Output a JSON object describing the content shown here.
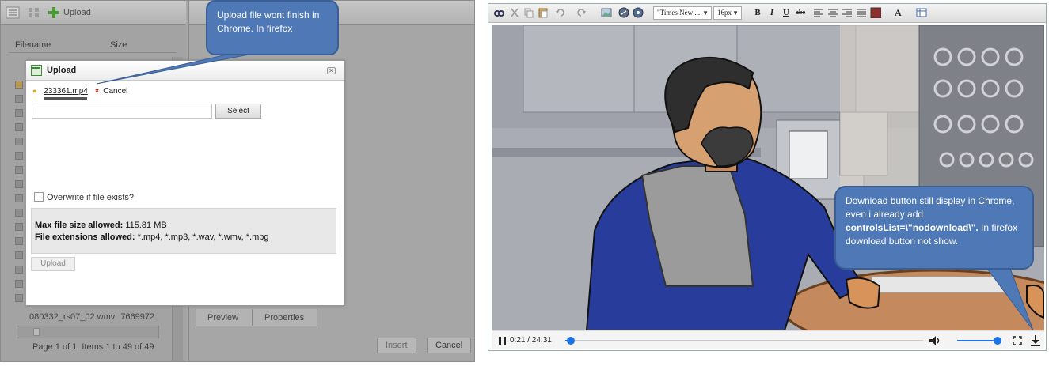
{
  "left": {
    "toolbar": {
      "upload_label": "Upload"
    },
    "list": {
      "col_filename": "Filename",
      "col_size": "Size",
      "last_row_name": "080332_rs07_02.wmv",
      "last_row_size": "7669972",
      "pager": "Page 1 of 1. Items 1 to 49 of 49"
    },
    "tabs": [
      "Preview",
      "Properties"
    ],
    "buttons": {
      "insert": "Insert",
      "cancel": "Cancel"
    },
    "dialog": {
      "title": "Upload",
      "file_name": "233361.mp4",
      "cancel_link": "Cancel",
      "select_button": "Select",
      "overwrite_label": "Overwrite if file exists?",
      "max_size_label": "Max file size allowed:",
      "max_size_value": "115.81 MB",
      "extensions_label": "File extensions allowed:",
      "extensions_value": "*.mp4, *.mp3, *.wav, *.wmv, *.mpg",
      "upload_button": "Upload",
      "progress_fraction": 0.25
    }
  },
  "callout1": {
    "text": "Upload file wont finish in Chrome. In firefox"
  },
  "editor": {
    "font_family": "\"Times New ...",
    "font_size": "16px",
    "format_buttons": [
      "B",
      "I",
      "U",
      "abc"
    ]
  },
  "video": {
    "time": "0:21 / 24:31",
    "played_fraction": 0.014,
    "volume_fraction": 1.0
  },
  "callout2": {
    "line1": "Download button still display in Chrome, even i already add",
    "code": "controlsList=\\\"nodownload\\\".",
    "line2": " In firefox download button not show."
  },
  "colors": {
    "callout_fill": "#4f79b6",
    "accent_blue": "#1a73e8",
    "dim_overlay": "#a9a9a9"
  }
}
